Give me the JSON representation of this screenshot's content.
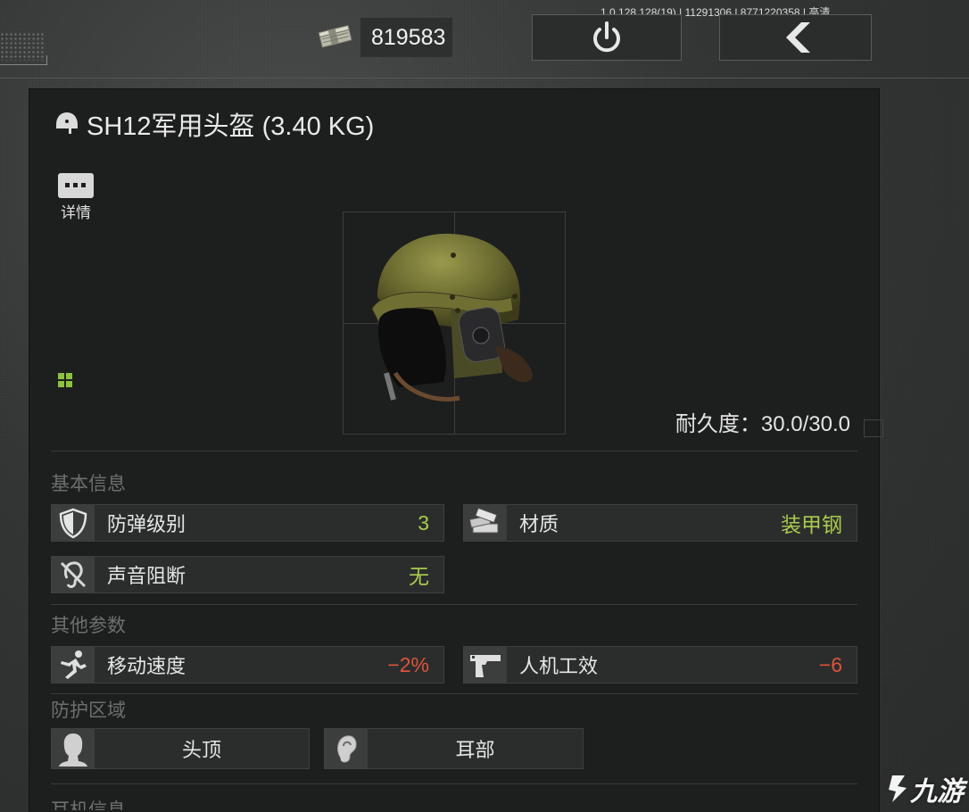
{
  "header": {
    "version": "1.0.128.128(19) | 11291306 | 8771220358 | 高清",
    "currency_icon": "cash-stack-icon",
    "currency_amount": "819583",
    "power_icon": "power-icon",
    "back_icon": "back-arrow-icon"
  },
  "item": {
    "icon": "helmet-icon",
    "title": "SH12军用头盔 (3.40 KG)",
    "details_label": "详情",
    "image_icon": "tank-helmet-image",
    "durability_label": "耐久度：30.0/30.0"
  },
  "sections": {
    "basic": "基本信息",
    "other": "其他参数",
    "protection": "防护区域",
    "cutoff": "耳机信息"
  },
  "basic_stats": [
    {
      "icon": "shield-icon",
      "name": "防弹级别",
      "value": "3",
      "color": "#a9cc4a"
    },
    {
      "icon": "armor-plates-icon",
      "name": "材质",
      "value": "装甲钢",
      "color": "#a9cc4a"
    },
    {
      "icon": "muted-ear-icon",
      "name": "声音阻断",
      "value": "无",
      "color": "#a9cc4a"
    }
  ],
  "other_stats": [
    {
      "icon": "running-man-icon",
      "name": "移动速度",
      "value": "−2%",
      "color": "#e0533a"
    },
    {
      "icon": "pistol-icon",
      "name": "人机工效",
      "value": "−6",
      "color": "#e0533a"
    }
  ],
  "zones": [
    {
      "icon": "head-silhouette-icon",
      "name": "头顶"
    },
    {
      "icon": "ear-icon",
      "name": "耳部"
    }
  ],
  "watermark": "九游"
}
